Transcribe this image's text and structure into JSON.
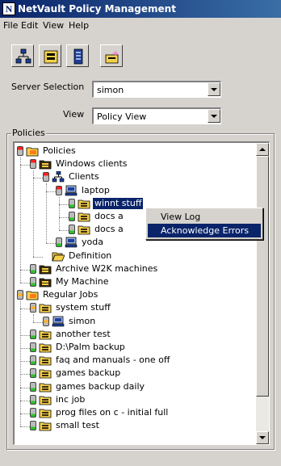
{
  "window": {
    "title": "NetVault Policy Management"
  },
  "menu": [
    "File",
    "Edit",
    "View",
    "Help"
  ],
  "toolbar": {
    "icons": [
      "network-icon",
      "folder-icon",
      "tower-icon",
      "wizard-icon"
    ]
  },
  "server_selection": {
    "label": "Server Selection",
    "value": "simon"
  },
  "view_selection": {
    "label": "View",
    "value": "Policy View"
  },
  "policies_group": {
    "label": "Policies"
  },
  "tree": [
    {
      "label": "Policies",
      "status": "red",
      "icon": "policy-folder",
      "level": 0
    },
    {
      "label": "Windows clients",
      "status": "red",
      "icon": "job-folder",
      "level": 1
    },
    {
      "label": "Clients",
      "status": "red",
      "icon": "network",
      "level": 2
    },
    {
      "label": "laptop",
      "status": "red",
      "icon": "computer",
      "level": 3
    },
    {
      "label": "winnt stuff",
      "status": "green",
      "icon": "job",
      "level": 4,
      "selected": true
    },
    {
      "label": "docs a",
      "status": "green",
      "icon": "job",
      "level": 4
    },
    {
      "label": "docs a",
      "status": "green",
      "icon": "job",
      "level": 4
    },
    {
      "label": "yoda",
      "status": "green",
      "icon": "computer",
      "level": 3
    },
    {
      "label": "Definition",
      "status": "none",
      "icon": "open-folder",
      "level": 2
    },
    {
      "label": "Archive W2K machines",
      "status": "green",
      "icon": "job-folder",
      "level": 1
    },
    {
      "label": "My Machine",
      "status": "green",
      "icon": "job-folder",
      "level": 1
    },
    {
      "label": "Regular Jobs",
      "status": "amber",
      "icon": "policy-folder",
      "level": 0
    },
    {
      "label": "system stuff",
      "status": "amber",
      "icon": "job",
      "level": 1
    },
    {
      "label": "simon",
      "status": "amber",
      "icon": "computer",
      "level": 2
    },
    {
      "label": "another test",
      "status": "green",
      "icon": "job",
      "level": 1
    },
    {
      "label": "D:\\Palm backup",
      "status": "green",
      "icon": "job",
      "level": 1
    },
    {
      "label": "faq and manuals - one off",
      "status": "green",
      "icon": "job",
      "level": 1
    },
    {
      "label": "games backup",
      "status": "green",
      "icon": "job",
      "level": 1
    },
    {
      "label": "games backup daily",
      "status": "green",
      "icon": "job",
      "level": 1
    },
    {
      "label": "inc job",
      "status": "green",
      "icon": "job",
      "level": 1
    },
    {
      "label": "prog files on c - initial full",
      "status": "green",
      "icon": "job",
      "level": 1
    },
    {
      "label": "small test",
      "status": "green",
      "icon": "job",
      "level": 1
    }
  ],
  "context_menu": {
    "items": [
      {
        "label": "View Log",
        "highlighted": false
      },
      {
        "label": "Acknowledge Errors",
        "highlighted": true
      }
    ]
  },
  "colors": {
    "selection": "#0a246a",
    "face": "#d6d3ce",
    "folder": "#f5d14a"
  }
}
